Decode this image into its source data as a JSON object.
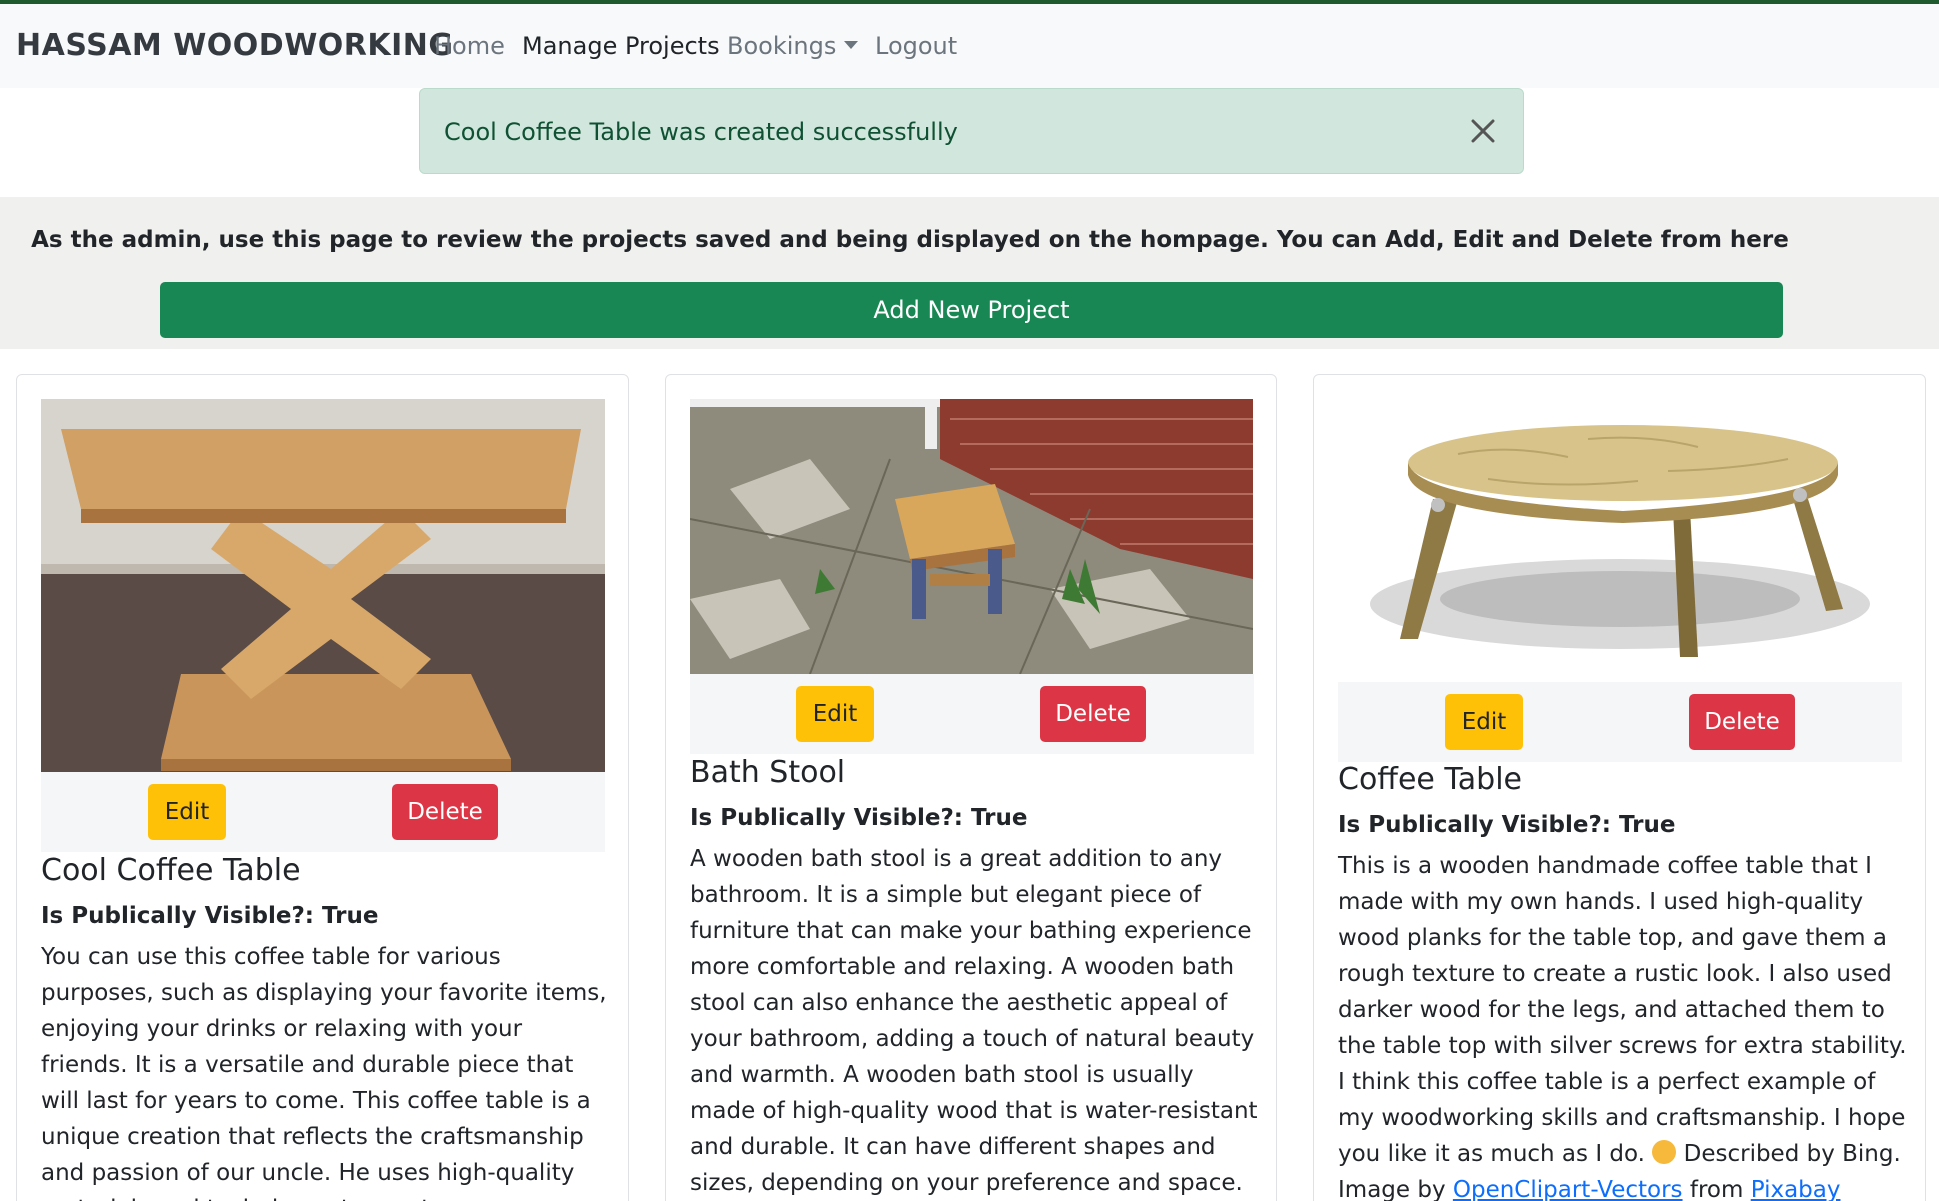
{
  "nav": {
    "brand": "HASSAM WOODWORKING",
    "home": "Home",
    "manage": "Manage Projects",
    "bookings": "Bookings",
    "logout": "Logout"
  },
  "alert": {
    "message": "Cool Coffee Table was created successfully"
  },
  "admin": {
    "intro": "As the admin, use this page to review the projects saved and being displayed on the hompage. You can Add, Edit and Delete from here",
    "add_button": "Add New Project"
  },
  "projects": [
    {
      "title": "Cool Coffee Table",
      "visibility": "Is Publically Visible?: True",
      "edit": "Edit",
      "delete": "Delete",
      "description": "You can use this coffee table for various purposes, such as displaying your favorite items, enjoying your drinks or relaxing with your friends. It is a versatile and durable piece that will last for years to come. This coffee table is a unique creation that reflects the craftsmanship and passion of our uncle. He uses high-quality materials and techniques to create"
    },
    {
      "title": "Bath Stool",
      "visibility": "Is Publically Visible?: True",
      "edit": "Edit",
      "delete": "Delete",
      "description": "A wooden bath stool is a great addition to any bathroom. It is a simple but elegant piece of furniture that can make your bathing experience more comfortable and relaxing. A wooden bath stool can also enhance the aesthetic appeal of your bathroom, adding a touch of natural beauty and warmth. A wooden bath stool is usually made of high-quality wood that is water-resistant and durable. It can have different shapes and sizes, depending on your preference and space. Some"
    },
    {
      "title": "Coffee Table",
      "visibility": "Is Publically Visible?: True",
      "edit": "Edit",
      "delete": "Delete",
      "description": "This is a wooden handmade coffee table that I made with my own hands. I used high-quality wood planks for the table top, and gave them a rough texture to create a rustic look. I also used darker wood for the legs, and attached them to the table top with silver screws for extra stability. I think this coffee table is a perfect example of my woodworking skills and craftsmanship. I hope you like it as much as I do.",
      "credit_prefix": "Described by Bing. Image by",
      "credit_author": "OpenClipart-Vectors",
      "credit_from": "from",
      "credit_site": "Pixabay"
    }
  ]
}
